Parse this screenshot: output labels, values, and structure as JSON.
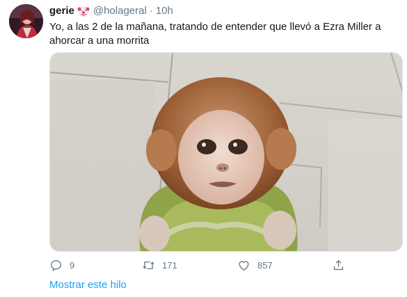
{
  "tweet": {
    "display_name": "gerie",
    "name_emoji": "clown-face-emoji",
    "handle": "@holageral",
    "separator": "·",
    "time": "10h",
    "text": "Yo, a las 2 de la mañana, tratando de entender que llevó a Ezra Miller a ahorcar a una morrita",
    "media": "baby-monkey-photo"
  },
  "actions": {
    "reply": {
      "icon": "reply-icon",
      "count": "9"
    },
    "retweet": {
      "icon": "retweet-icon",
      "count": "171"
    },
    "like": {
      "icon": "heart-icon",
      "count": "857"
    },
    "share": {
      "icon": "share-icon"
    }
  },
  "thread_link": "Mostrar este hilo",
  "colors": {
    "text": "#14171a",
    "secondary": "#657786",
    "link": "#1da1f2",
    "border": "#e1e8ed"
  }
}
